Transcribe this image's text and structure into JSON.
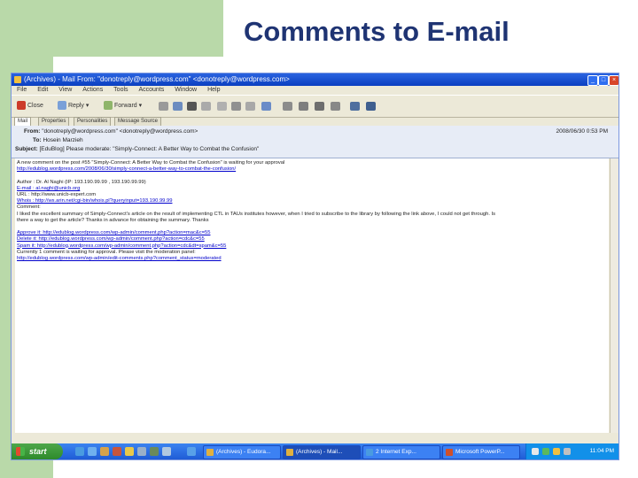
{
  "slide": {
    "title": "Comments to E-mail"
  },
  "window": {
    "title": "(Archives) - Mail From: \"donotreply@wordpress.com\" <donotreply@wordpress.com>",
    "menu": [
      "File",
      "Edit",
      "View",
      "Actions",
      "Tools",
      "Accounts",
      "Window",
      "Help"
    ],
    "toolbar": {
      "close": "Close",
      "reply": "Reply",
      "forward": "Forward"
    },
    "tabs": [
      "Mail",
      "Properties",
      "Personalities",
      "Message Source"
    ]
  },
  "header": {
    "from_label": "From:",
    "from_value": "\"donotreply@wordpress.com\" <donotreply@wordpress.com>",
    "to_label": "To:",
    "to_value": "Hosein Marzieh",
    "subject_label": "Subject:",
    "subject_value": "[EduBlog] Please moderate: \"Simply-Connect: A Better Way to Combat the Confusion\"",
    "date": "2008/06/30 0:53 PM"
  },
  "body": [
    {
      "text": "A new comment on the post #55 \"Simply-Connect: A Better Way to Combat the Confusion\" is waiting for your approval",
      "link": false
    },
    {
      "text": "http://edublog.wordpress.com/2008/06/30/simply-connect-a-better-way-to-combat-the-confusion/",
      "link": true
    },
    {
      "text": "",
      "link": false
    },
    {
      "text": "Author : Dr. Al Naghi (IP: 193.190.99.99 , 193.190.99.99)",
      "link": false
    },
    {
      "text": "E-mail : al.naghi@unicb.org",
      "link": true
    },
    {
      "text": "URL : http://www.unicb-expert.com",
      "link": false
    },
    {
      "text": "Whois : http://ws.arin.net/cgi-bin/whois.pl?queryinput=193.190.99.99",
      "link": true
    },
    {
      "text": "Comment:",
      "link": false
    },
    {
      "text": "I liked the excellent summary of Simply-Connect's article on the result of implementing CTL in TAUs institutes however, when I tried to subscribe to the library by following the link above, I could not get through. Is",
      "link": false
    },
    {
      "text": "there a way to get the article? Thanks in advance for obtaining the summary. Thanks",
      "link": false
    },
    {
      "text": "",
      "link": false
    },
    {
      "text": "Approve it: http://edublog.wordpress.com/wp-admin/comment.php?action=mac&c=55",
      "link": true
    },
    {
      "text": "Delete it: http://edublog.wordpress.com/wp-admin/comment.php?action=cdc&c=55",
      "link": true
    },
    {
      "text": "Spam it: http://edublog.wordpress.com/wp-admin/comment.php?action=cdc&dt=spam&c=55",
      "link": true
    },
    {
      "text": "Currently 1 comment is waiting for approval. Please visit the moderation panel:",
      "link": false
    },
    {
      "text": "http://edublog.wordpress.com/wp-admin/edit-comments.php?comment_status=moderated",
      "link": true
    }
  ],
  "taskbar": {
    "start": "start",
    "tasks": [
      "(Archives) - Eudora...",
      "(Archives) - Mail...",
      "2 Internet Exp...",
      "Microsoft PowerP..."
    ],
    "clock": "11:04 PM"
  },
  "colors": {
    "slide_band": "#b9d9a9",
    "title": "#1f3473",
    "titlebar": "#0a3fc0",
    "taskbar": "#1f5cd6",
    "start": "#2d8a2b"
  }
}
